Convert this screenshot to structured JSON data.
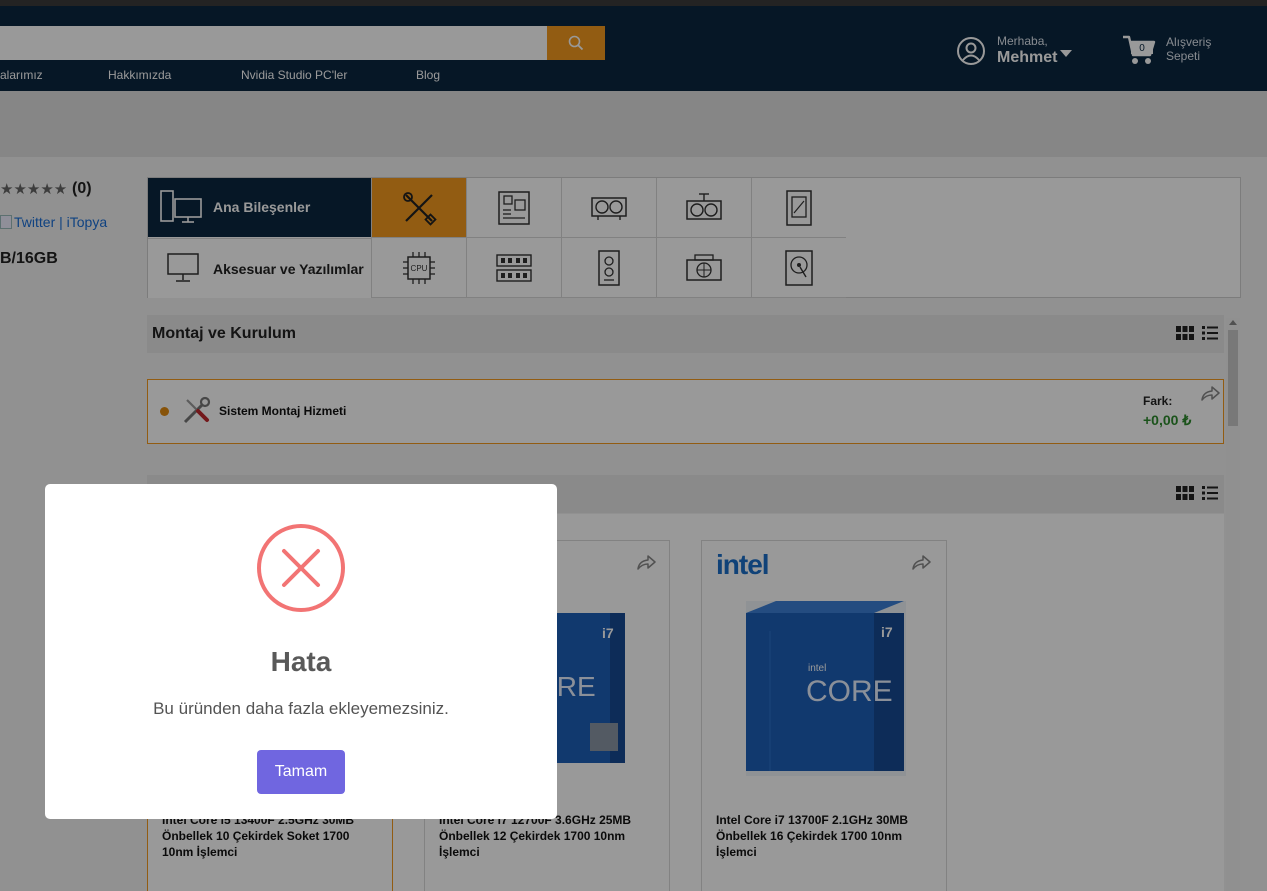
{
  "header": {
    "search_placeholder": "",
    "nav": [
      "alarımız",
      "Hakkımızda",
      "Nvidia Studio PC'ler",
      "Blog"
    ],
    "account": {
      "greeting": "Merhaba,",
      "name": "Mehmet"
    },
    "cart": {
      "count": "0",
      "line1": "Alışveriş",
      "line2": "Sepeti"
    }
  },
  "left": {
    "stars": "★★★★★",
    "rating_count": "(0)",
    "twitter_alt": "Twitter | iTopya",
    "spec": "B/16GB"
  },
  "categories": {
    "main_label": "Ana Bileşenler",
    "accessory_label": "Aksesuar ve Yazılımlar",
    "cpu_chip_text": "CPU"
  },
  "sections": {
    "montaj_title": "Montaj ve Kurulum",
    "montaj_item": "Sistem Montaj Hizmeti",
    "fark_label": "Fark:",
    "fark_value": "+0,00 ₺"
  },
  "products": [
    {
      "name": "Intel Core i5 13400F 2.5GHz 30MB Önbellek 10 Çekirdek Soket 1700 10nm İşlemci",
      "visible_name": "Intel Core i5 13400F 2.5GHz 30MB\nÖnbellek 10 Çekirdek Soket 1700\n10nm İşlemci"
    },
    {
      "name": "Intel Core i7 12700F 3.6GHz 25MB Önbellek 12 Çekirdek 1700 10nm İşlemci",
      "visible_name": "Intel Core i7 12700F 3.6GHz 25MB\nÖnbellek 12 Çekirdek 1700 10nm\nİşlemci"
    },
    {
      "name": "Intel Core i7 13700F 2.1GHz 30MB Önbellek 16 Çekirdek 1700 10nm İşlemci",
      "logo": "intel",
      "box_badge": "i7",
      "box_brand": "intel",
      "box_text": "CORE"
    }
  ],
  "modal": {
    "title": "Hata",
    "message": "Bu üründen daha fazla ekleyemezsiniz.",
    "confirm": "Tamam"
  },
  "colors": {
    "header_bg": "#0a2740",
    "accent_orange": "#f39a1e",
    "error_red": "#f27474",
    "confirm_purple": "#7066e0",
    "price_green": "#2e8b2e"
  }
}
